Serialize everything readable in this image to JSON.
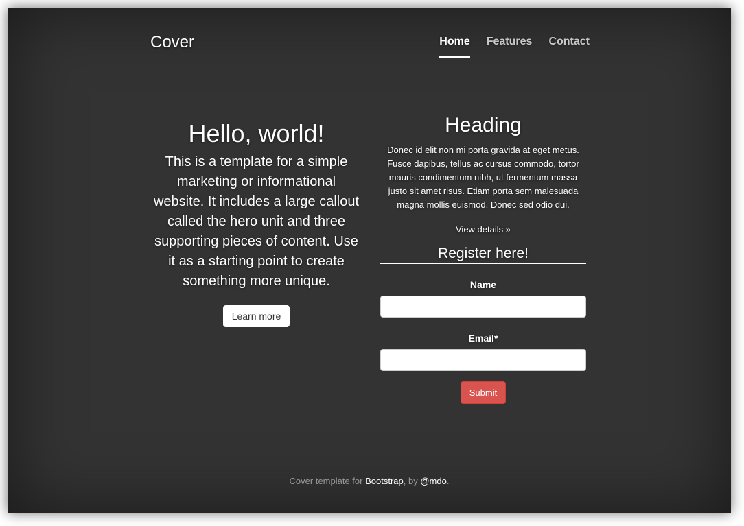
{
  "header": {
    "brand": "Cover",
    "nav": [
      {
        "label": "Home",
        "active": true
      },
      {
        "label": "Features",
        "active": false
      },
      {
        "label": "Contact",
        "active": false
      }
    ]
  },
  "hero": {
    "title": "Hello, world!",
    "body": "This is a template for a simple marketing or informational website. It includes a large callout called the hero unit and three supporting pieces of content. Use it as a starting point to create something more unique.",
    "button_label": "Learn more"
  },
  "side": {
    "title": "Heading",
    "body": "Donec id elit non mi porta gravida at eget metus. Fusce dapibus, tellus ac cursus commodo, tortor mauris condimentum nibh, ut fermentum massa justo sit amet risus. Etiam porta sem malesuada magna mollis euismod. Donec sed odio dui.",
    "link_label": "View details »"
  },
  "form": {
    "title": "Register here!",
    "name_label": "Name",
    "name_value": "",
    "email_label": "Email*",
    "email_value": "",
    "submit_label": "Submit"
  },
  "footer": {
    "prefix": "Cover template for ",
    "link1": "Bootstrap",
    "middle": ", by ",
    "link2": "@mdo",
    "suffix": "."
  },
  "colors": {
    "background": "#333333",
    "submit": "#d9534f"
  }
}
